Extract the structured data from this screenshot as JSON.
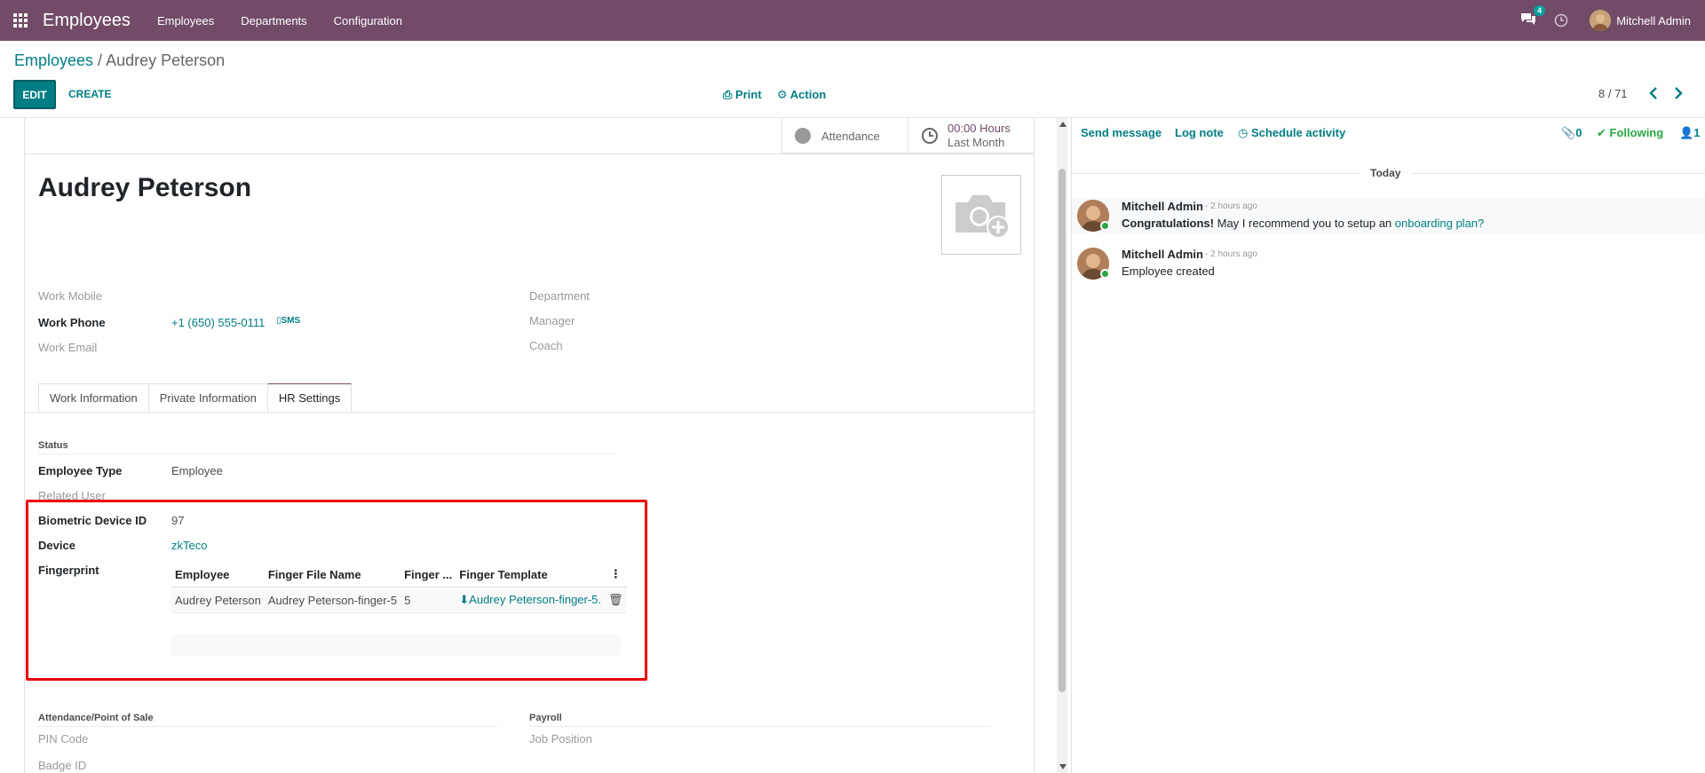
{
  "navbar": {
    "app_name": "Employees",
    "menu": [
      "Employees",
      "Departments",
      "Configuration"
    ],
    "messages_count": "4",
    "user_name": "Mitchell Admin"
  },
  "control_panel": {
    "breadcrumb_parent": "Employees",
    "breadcrumb_separator": " / ",
    "breadcrumb_current": "Audrey Peterson",
    "edit_label": "EDIT",
    "create_label": "CREATE",
    "print_label": "Print",
    "action_label": "Action",
    "pager": "8 / 71"
  },
  "stat_buttons": {
    "attendance_label": "Attendance",
    "hours_value": "00:00 Hours",
    "hours_label": "Last Month"
  },
  "employee": {
    "name": "Audrey Peterson",
    "work_mobile_label": "Work Mobile",
    "work_phone_label": "Work Phone",
    "work_phone_value": "+1 (650) 555-0111",
    "sms_label": "SMS",
    "work_email_label": "Work Email",
    "department_label": "Department",
    "manager_label": "Manager",
    "coach_label": "Coach"
  },
  "tabs": [
    "Work Information",
    "Private Information",
    "HR Settings"
  ],
  "hr_settings": {
    "status_title": "Status",
    "employee_type_label": "Employee Type",
    "employee_type_value": "Employee",
    "related_user_label": "Related User",
    "biometric_label": "Biometric Device ID",
    "biometric_value": "97",
    "device_label": "Device",
    "device_value": "zkTeco",
    "fingerprint_label": "Fingerprint",
    "fingerprint_columns": [
      "Employee",
      "Finger File Name",
      "Finger ...",
      "Finger Template"
    ],
    "fingerprint_rows": [
      {
        "employee": "Audrey Peterson",
        "file_name": "Audrey Peterson-finger-5",
        "finger": "5",
        "template": "Audrey Peterson-finger-5."
      }
    ],
    "attendance_title": "Attendance/Point of Sale",
    "pin_code_label": "PIN Code",
    "badge_id_label": "Badge ID",
    "payroll_title": "Payroll",
    "job_position_label": "Job Position"
  },
  "chatter": {
    "send_message": "Send message",
    "log_note": "Log note",
    "schedule_activity": "Schedule activity",
    "attachments_count": "0",
    "following": "Following",
    "followers_count": "1",
    "today_label": "Today",
    "messages": [
      {
        "author": "Mitchell Admin",
        "time": "- 2 hours ago",
        "body_bold": "Congratulations!",
        "body": " May I recommend you to setup an ",
        "link": "onboarding plan?"
      },
      {
        "author": "Mitchell Admin",
        "time": "- 2 hours ago",
        "body_bold": "",
        "body": "Employee created",
        "link": ""
      }
    ]
  },
  "colors": {
    "brand": "#714b67",
    "accent": "#017e84",
    "highlight_box": "#e8000b",
    "following": "#28a745"
  }
}
